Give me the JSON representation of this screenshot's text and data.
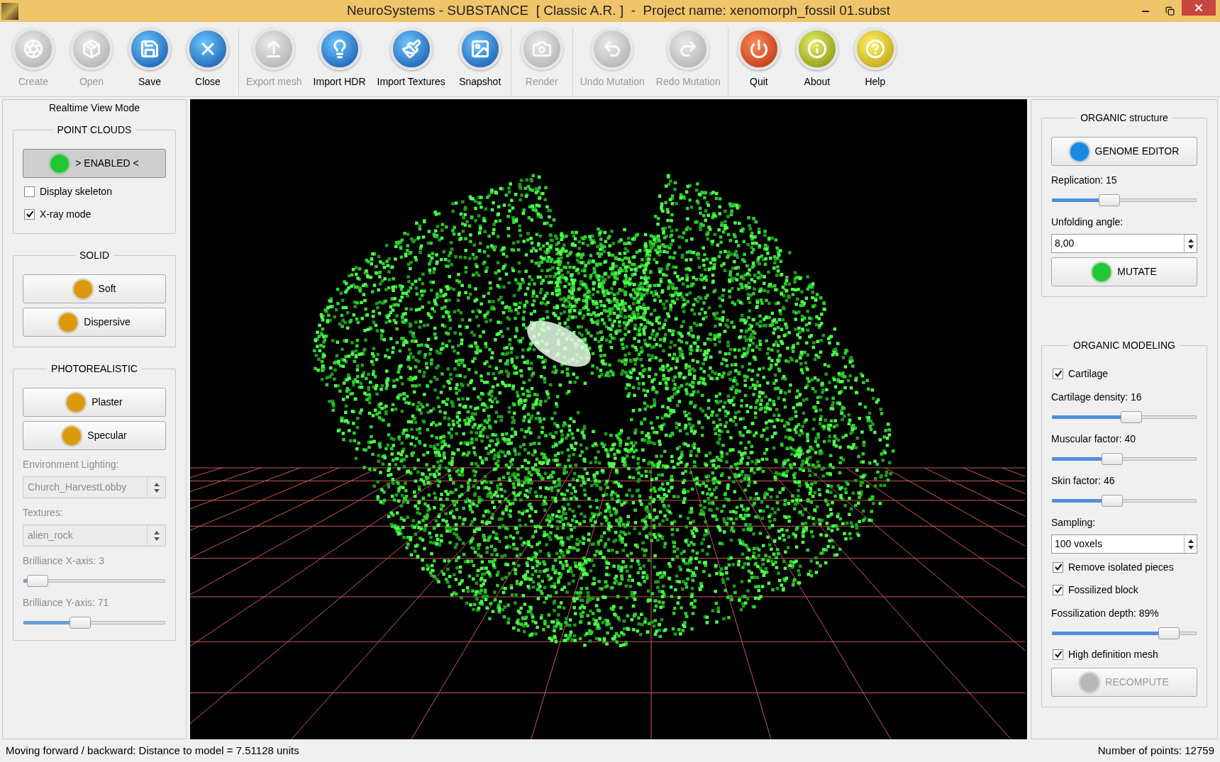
{
  "window": {
    "title": "NeuroSystems - SUBSTANCE  [ Classic A.R. ]  -  Project name: xenomorph_fossil 01.subst"
  },
  "toolbar": [
    {
      "label": "Create",
      "kind": "create",
      "disabled": true
    },
    {
      "label": "Open",
      "kind": "open",
      "disabled": true
    },
    {
      "label": "Save",
      "kind": "save",
      "disabled": false
    },
    {
      "label": "Close",
      "kind": "close",
      "disabled": false
    },
    {
      "label": "Export mesh",
      "kind": "export",
      "disabled": true
    },
    {
      "label": "Import HDR",
      "kind": "hdr",
      "disabled": false
    },
    {
      "label": "Import Textures",
      "kind": "textures",
      "disabled": false
    },
    {
      "label": "Snapshot",
      "kind": "snapshot",
      "disabled": false
    },
    {
      "label": "Render",
      "kind": "render",
      "disabled": true
    },
    {
      "label": "Undo Mutation",
      "kind": "undo",
      "disabled": true
    },
    {
      "label": "Redo Mutation",
      "kind": "redo",
      "disabled": true
    },
    {
      "label": "Quit",
      "kind": "quit",
      "disabled": false
    },
    {
      "label": "About",
      "kind": "about",
      "disabled": false
    },
    {
      "label": "Help",
      "kind": "help",
      "disabled": false
    }
  ],
  "left_panel": {
    "title": "Realtime View Mode",
    "groups": [
      {
        "title": "POINT CLOUDS",
        "items": [
          {
            "kind": "button",
            "label": "> ENABLED <",
            "color": "#22c833",
            "selected": true,
            "disabled": false
          },
          {
            "kind": "checkbox",
            "label": "Display skeleton",
            "checked": false
          },
          {
            "kind": "checkbox",
            "label": "X-ray mode",
            "checked": true
          }
        ]
      },
      {
        "title": "SOLID",
        "items": [
          {
            "kind": "button",
            "label": "Soft",
            "color": "#d99a10",
            "selected": false,
            "disabled": false
          },
          {
            "kind": "button",
            "label": "Dispersive",
            "color": "#d99a10",
            "selected": false,
            "disabled": false
          }
        ]
      },
      {
        "title": "PHOTOREALISTIC",
        "items": [
          {
            "kind": "button",
            "label": "Plaster",
            "color": "#d99a10",
            "selected": false,
            "disabled": false
          },
          {
            "kind": "button",
            "label": "Specular",
            "color": "#d99a10",
            "selected": false,
            "disabled": false
          },
          {
            "kind": "label",
            "text": "Environment Lighting:",
            "disabled": true
          },
          {
            "kind": "select",
            "value": "Church_HarvestLobby",
            "disabled": true
          },
          {
            "kind": "label",
            "text": "Textures:",
            "disabled": true
          },
          {
            "kind": "select",
            "value": "alien_rock",
            "disabled": true
          },
          {
            "kind": "label",
            "text": "Brilliance X-axis: 3",
            "disabled": true
          },
          {
            "kind": "slider",
            "level": 0.03,
            "disabled": true
          },
          {
            "kind": "label",
            "text": "Brilliance Y-axis: 71",
            "disabled": true
          },
          {
            "kind": "slider",
            "level": 0.38,
            "disabled": true
          }
        ]
      }
    ]
  },
  "right_panel": {
    "groups": [
      {
        "title": "ORGANIC structure",
        "items": [
          {
            "kind": "button",
            "label": "GENOME EDITOR",
            "color": "#1a8ae0",
            "selected": false,
            "disabled": false
          },
          {
            "kind": "label",
            "text": "Replication: 15",
            "disabled": false
          },
          {
            "kind": "slider",
            "level": 0.38,
            "disabled": false
          },
          {
            "kind": "label",
            "text": "Unfolding angle:",
            "disabled": false
          },
          {
            "kind": "spin",
            "value": "8,00"
          },
          {
            "kind": "button",
            "label": "MUTATE",
            "color": "#22c833",
            "selected": false,
            "disabled": false
          }
        ]
      },
      {
        "title": "ORGANIC MODELING",
        "items": [
          {
            "kind": "checkbox",
            "label": "Cartilage",
            "checked": true
          },
          {
            "kind": "label",
            "text": "Cartilage density: 16",
            "disabled": false
          },
          {
            "kind": "slider",
            "level": 0.56,
            "disabled": false
          },
          {
            "kind": "label",
            "text": "Muscular factor: 40",
            "disabled": false
          },
          {
            "kind": "slider",
            "level": 0.4,
            "disabled": false
          },
          {
            "kind": "label",
            "text": "Skin factor: 46",
            "disabled": false
          },
          {
            "kind": "slider",
            "level": 0.4,
            "disabled": false
          },
          {
            "kind": "label",
            "text": "Sampling:",
            "disabled": false
          },
          {
            "kind": "spin",
            "value": "100 voxels"
          },
          {
            "kind": "checkbox",
            "label": "Remove isolated pieces",
            "checked": true
          },
          {
            "kind": "checkbox",
            "label": "Fossilized block",
            "checked": true
          },
          {
            "kind": "label",
            "text": "Fossilization depth: 89%",
            "disabled": false
          },
          {
            "kind": "slider",
            "level": 0.86,
            "disabled": false
          },
          {
            "kind": "checkbox",
            "label": "High definition mesh",
            "checked": true
          },
          {
            "kind": "button",
            "label": "RECOMPUTE",
            "color": "#b8b8b8",
            "selected": false,
            "disabled": true
          }
        ]
      }
    ]
  },
  "status_bar": {
    "left": "Moving forward / backward: Distance to model = 7.51128 units",
    "right": "Number of points: 12759"
  }
}
